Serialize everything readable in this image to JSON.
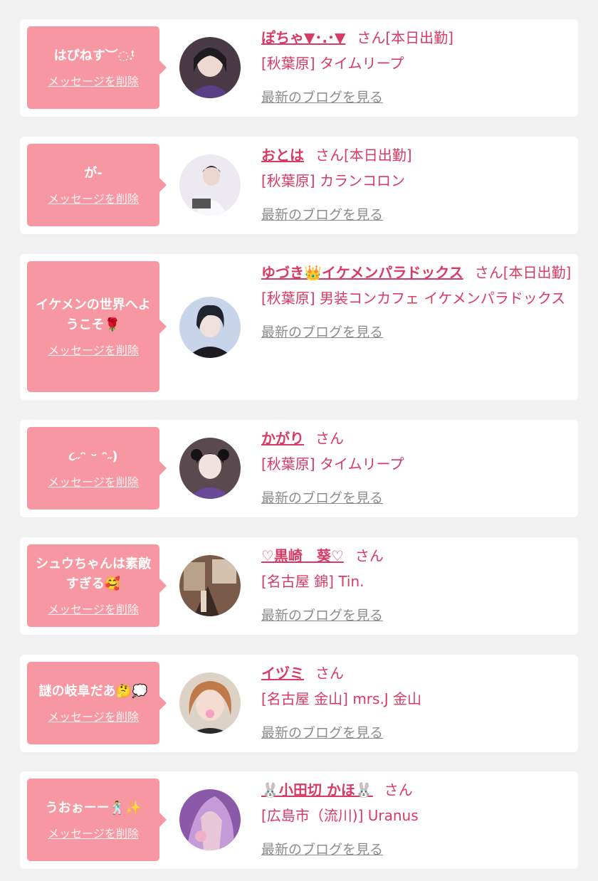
{
  "colors": {
    "bubble": "#f797a1",
    "accent": "#d83a63",
    "link_gray": "#8c8c8c",
    "background": "#f1f1f1"
  },
  "delete_label": "メッセージを削除",
  "blog_label": "最新のブログを見る",
  "cards": [
    {
      "message": "はぴねす︶◌.ͭ",
      "name": "ぽちゃ▼･.･▼",
      "suffix": "さん[本日出勤]",
      "shop": "[秋葉原] タイムリープ"
    },
    {
      "message": "が-",
      "name": "おとは",
      "suffix": "さん[本日出勤]",
      "shop": "[秋葉原] カランコロン"
    },
    {
      "message": "イケメンの世界へようこそ🌹",
      "name": "ゆづき👑イケメンパラドックス",
      "suffix": "さん[本日出勤]",
      "shop": "[秋葉原] 男装コンカフェ イケメンパラドックス"
    },
    {
      "message": "૮˶ᵔ ᵕ ᵔ˶)",
      "name": "かがり",
      "suffix": "さん",
      "shop": "[秋葉原] タイムリープ"
    },
    {
      "message": "シュウちゃんは素敵すぎる🥰",
      "name": "♡黒崎　葵♡",
      "suffix": "さん",
      "shop": "[名古屋 錦] Tin."
    },
    {
      "message": "謎の岐阜だあ🤔💭",
      "name": "イヅミ",
      "suffix": "さん",
      "shop": "[名古屋 金山] mrs.J 金山"
    },
    {
      "message": "うおぉーー🕺✨",
      "name": "🐰小田切 かほ🐰",
      "suffix": "さん",
      "shop": "[広島市（流川)] Uranus"
    }
  ]
}
